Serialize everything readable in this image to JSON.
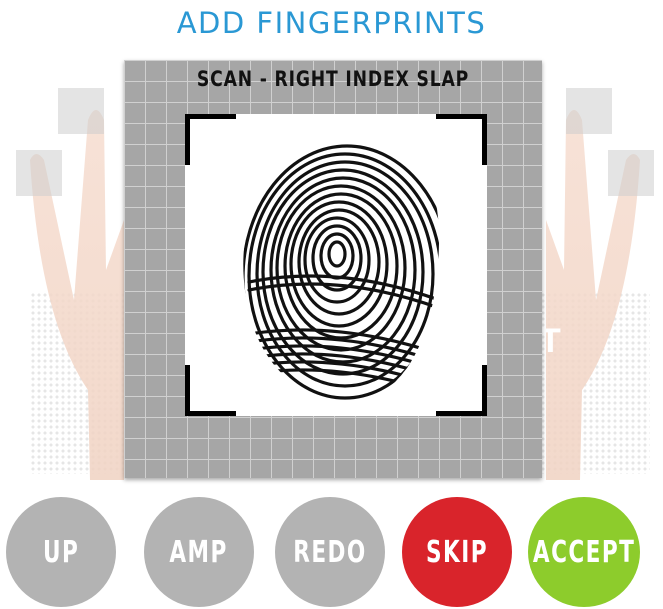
{
  "header": {
    "title": "ADD FINGERPRINTS"
  },
  "scan": {
    "label": "SCAN - RIGHT INDEX SLAP"
  },
  "background_letter": "T",
  "buttons": [
    {
      "label": "UP",
      "name": "up-button",
      "color": "#b3b3b3"
    },
    {
      "label": "AMP",
      "name": "amp-button",
      "color": "#b3b3b3"
    },
    {
      "label": "REDO",
      "name": "redo-button",
      "color": "#b3b3b3"
    },
    {
      "label": "SKIP",
      "name": "skip-button",
      "color": "#d9242b"
    },
    {
      "label": "ACCEPT",
      "name": "accept-button",
      "color": "#8dcc2c"
    }
  ],
  "colors": {
    "title": "#2a98d4",
    "panel": "#a6a6a6",
    "grid": "#d0d0d0"
  },
  "icons": {
    "fingerprint": "fingerprint-image",
    "hands": "hand-illustration"
  }
}
